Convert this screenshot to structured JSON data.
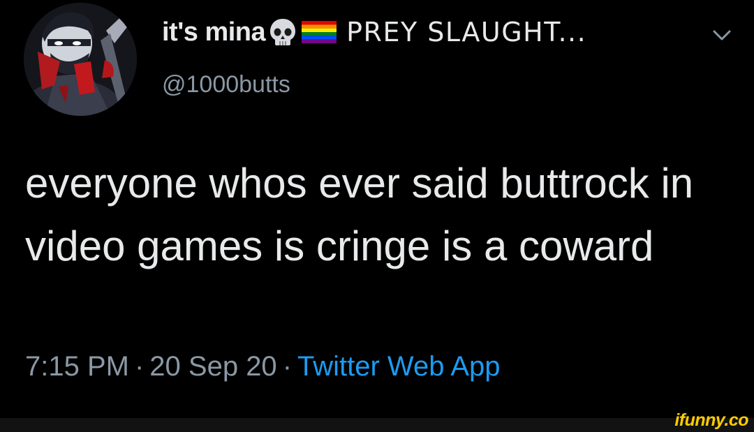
{
  "tweet": {
    "display_name": "it's mina",
    "display_name_suffix": "PREY SLAUGHT...",
    "emojis": [
      "skull-emoji",
      "rainbow-flag-emoji"
    ],
    "handle": "@1000butts",
    "text": "everyone whos ever said buttrock in video games is cringe is a coward",
    "time": "7:15 PM",
    "date": "20 Sep 20",
    "separator": "·",
    "source": "Twitter Web App"
  },
  "icons": {
    "menu": "chevron-down-icon"
  },
  "watermark": {
    "text": "ifunny.co"
  },
  "colors": {
    "background": "#000000",
    "text_primary": "#e7e9ea",
    "text_secondary": "#8b98a5",
    "link": "#1d9bf0",
    "watermark": "#ffcc00"
  }
}
